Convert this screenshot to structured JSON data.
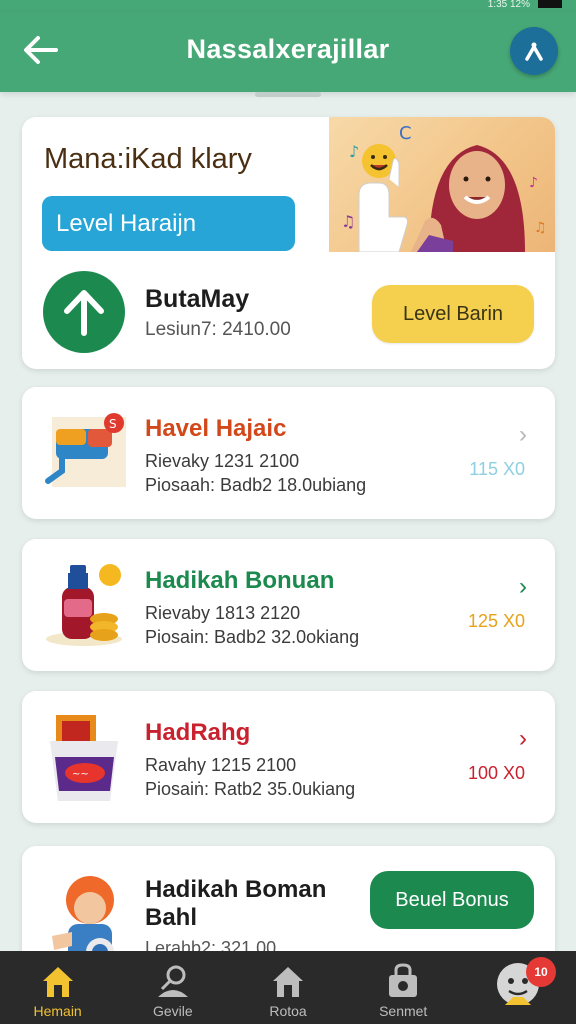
{
  "status_bar": {
    "text": "1:35 12%"
  },
  "app_bar": {
    "title": "Nassalxerajillar"
  },
  "hero": {
    "heading": "Mana:iKad klary",
    "level_pill": "Level Haraijn",
    "name": "ButaMay",
    "sub": "Lesiun7: 2410.00",
    "button": "Level Barin"
  },
  "items": [
    {
      "title": "Havel Hajaic",
      "title_color": "#d2481b",
      "line1": "Rievaky 1231 2100",
      "line2": "Piosaah: Badb2 18.0ubiang",
      "points": "115 X0",
      "points_color": "#8dd0e0",
      "chevron_color": "#b7b7b7"
    },
    {
      "title": "Hadikah Bonuan",
      "title_color": "#1c8a4f",
      "line1": "Rievaby 1813 2120",
      "line2": "Piosain: Badb2 32.0okiang",
      "points": "125 X0",
      "points_color": "#e6a21a",
      "chevron_color": "#1c8a4f"
    },
    {
      "title": "HadRahg",
      "title_color": "#c9222f",
      "line1": "Ravahy 1215 2100",
      "line2": "Piosaiṅ: Ratb2 35.0ukiang",
      "points": "100 X0",
      "points_color": "#c9222f",
      "chevron_color": "#c9222f"
    }
  ],
  "last_card": {
    "title": "Hadikah Boman Bahl",
    "sub": "Lerahb2: 321.00",
    "button": "Beuel Bonus"
  },
  "nav": [
    {
      "label": "Hemain",
      "icon": "home-icon",
      "active": true
    },
    {
      "label": "Gevile",
      "icon": "search-profile-icon",
      "active": false
    },
    {
      "label": "Rotoa",
      "icon": "home-outline-icon",
      "active": false
    },
    {
      "label": "Senmet",
      "icon": "bag-icon",
      "active": false
    },
    {
      "label": "",
      "icon": "avatar-icon",
      "active": false
    }
  ],
  "notification_count": "10",
  "colors": {
    "primary": "#47a877",
    "dark_green": "#1c8a4f",
    "blue": "#26a5d6",
    "yellow": "#f5d04e"
  }
}
